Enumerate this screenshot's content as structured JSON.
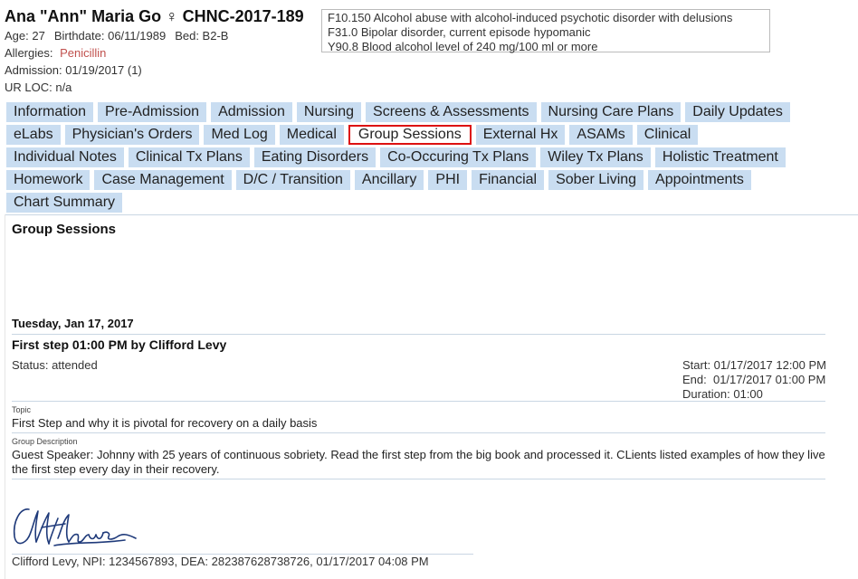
{
  "patient": {
    "name": "Ana \"Ann\" Maria Go",
    "gender_symbol": "♀",
    "chart_id": "CHNC-2017-189",
    "age": "Age: 27",
    "birthdate": "Birthdate: 06/11/1989",
    "bed": "Bed: B2-B",
    "allergies_label": "Allergies:",
    "allergies_value": "Penicillin",
    "admission": "Admission: 01/19/2017 (1)",
    "ur_loc": "UR LOC: n/a"
  },
  "diagnoses": [
    "F10.150 Alcohol abuse with alcohol-induced psychotic disorder with delusions",
    "F31.0 Bipolar disorder, current episode hypomanic",
    "Y90.8 Blood alcohol level of 240 mg/100 ml or more"
  ],
  "tabs": {
    "rows": [
      [
        "Information",
        "Pre-Admission",
        "Admission",
        "Nursing",
        "Screens & Assessments",
        "Nursing Care Plans",
        "Daily Updates"
      ],
      [
        "eLabs",
        "Physician's Orders",
        "Med Log",
        "Medical",
        "Group Sessions",
        "External Hx",
        "ASAMs",
        "Clinical"
      ],
      [
        "Individual Notes",
        "Clinical Tx Plans",
        "Eating Disorders",
        "Co-Occuring Tx Plans",
        "Wiley Tx Plans",
        "Holistic Treatment"
      ],
      [
        "Homework",
        "Case Management",
        "D/C / Transition",
        "Ancillary",
        "PHI",
        "Financial",
        "Sober Living",
        "Appointments"
      ],
      [
        "Chart Summary"
      ]
    ],
    "active": "Group Sessions"
  },
  "section": {
    "title": "Group Sessions",
    "date": "Tuesday, Jan 17, 2017",
    "session_title": "First step 01:00 PM by Clifford Levy",
    "status": "Status: attended",
    "start": "Start: 01/17/2017 12:00 PM",
    "end": "End:  01/17/2017 01:00 PM",
    "duration": "Duration: 01:00",
    "topic_label": "Topic",
    "topic": "First Step and why it is pivotal for recovery on a daily basis",
    "description_label": "Group Description",
    "description": "Guest Speaker: Johnny with 25 years of continuous sobriety. Read the first step from the big book and processed it. CLients listed examples of how they live the first step every day in their recovery.",
    "signature": "Clifford Levy, NPI: 1234567893, DEA: 282387628738726, 01/17/2017 04:08 PM"
  },
  "colors": {
    "tab_bg": "#c9ddf1",
    "active_border": "#dd1111",
    "allergy": "#c0504d",
    "signature_ink": "#1f3a7a"
  }
}
